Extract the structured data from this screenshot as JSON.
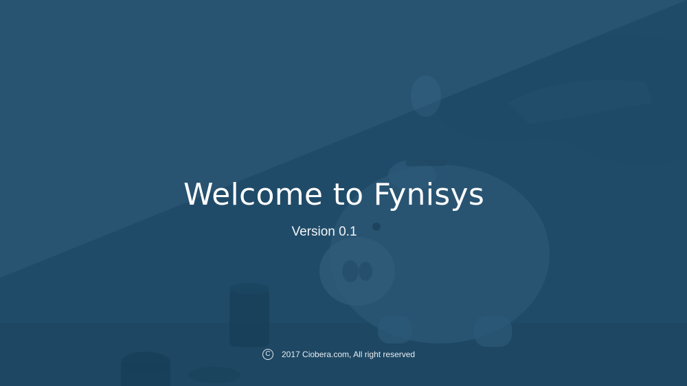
{
  "splash": {
    "title": "Welcome to Fynisys",
    "version": "Version 0.1",
    "footer": {
      "copyright_icon": "copyright-icon",
      "copyright_symbol": "C",
      "text": "2017 Ciobera.com, All right reserved"
    },
    "colors": {
      "overlay": "#254f6c",
      "text": "#ffffff"
    },
    "background_image": "piggy-bank-with-coins-photo"
  }
}
